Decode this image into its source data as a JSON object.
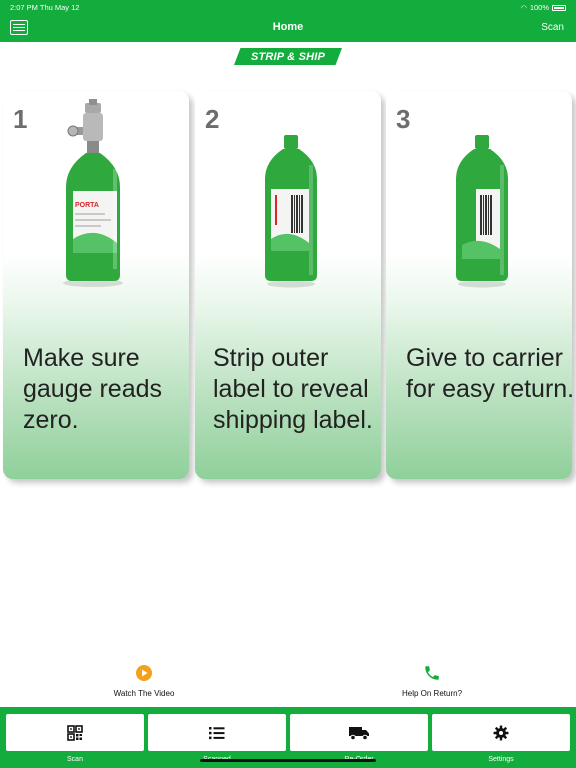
{
  "status_bar": {
    "time": "2:07 PM   Thu May 12",
    "battery": "100%"
  },
  "nav": {
    "title": "Home",
    "scan": "Scan"
  },
  "logo": {
    "text": "STRIP & SHIP"
  },
  "steps": [
    {
      "number": "1",
      "text": "Make sure gauge reads zero.",
      "label_text": "PORTA"
    },
    {
      "number": "2",
      "text": "Strip outer label to reveal shipping label."
    },
    {
      "number": "3",
      "text": "Give to carrier for easy return."
    }
  ],
  "actions": {
    "watch_video": "Watch The Video",
    "help_return": "Help On Return?"
  },
  "colors": {
    "brand_green": "#12ad3c",
    "video_orange": "#f5a01a"
  },
  "tabs": [
    {
      "label": "Scan",
      "icon": "qr-code-icon"
    },
    {
      "label": "Scanned",
      "icon": "list-icon"
    },
    {
      "label": "Re-Order",
      "icon": "truck-icon"
    },
    {
      "label": "Settings",
      "icon": "gear-icon"
    }
  ]
}
